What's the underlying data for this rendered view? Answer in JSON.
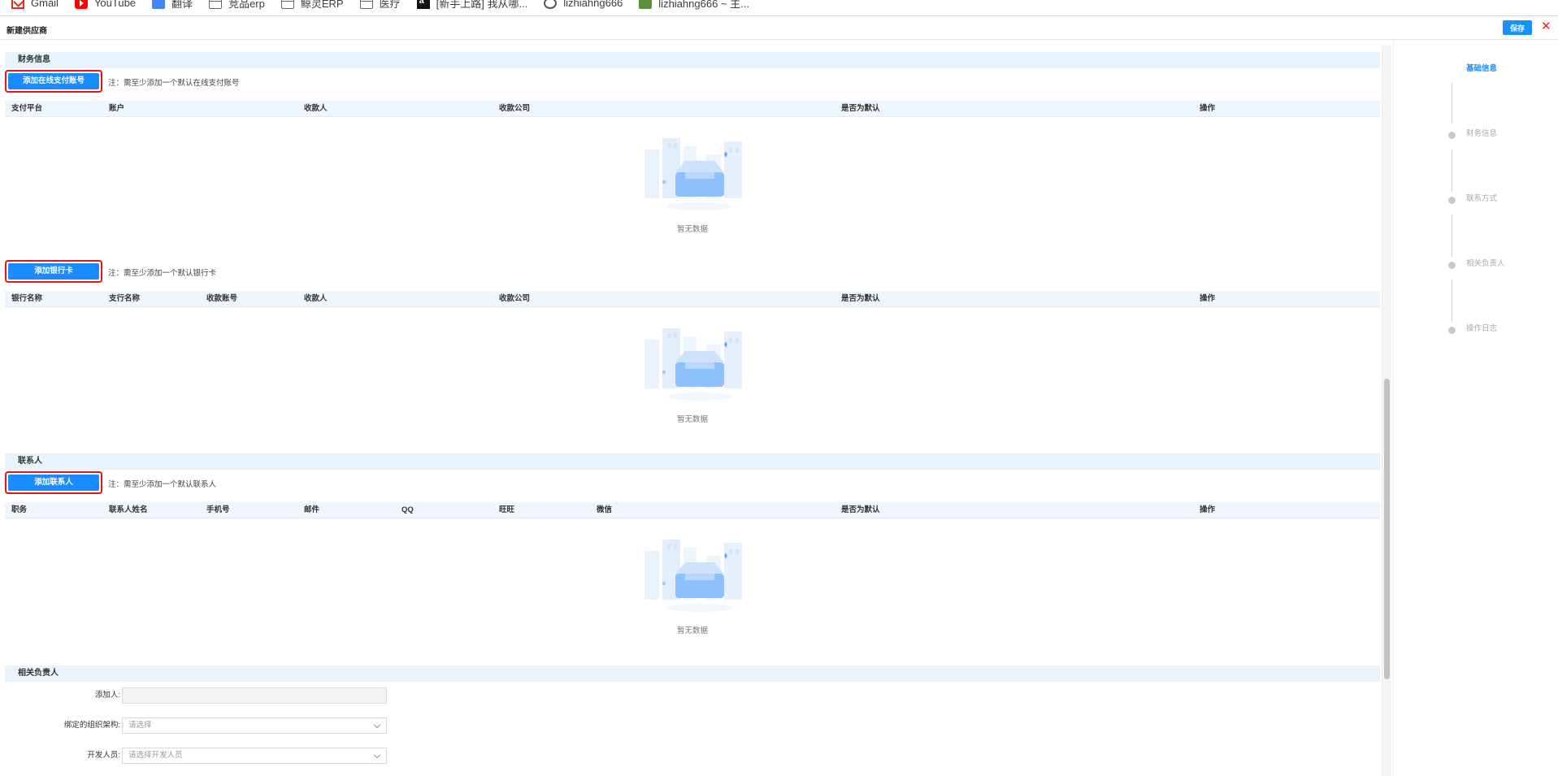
{
  "bookmarks": [
    {
      "label": "Gmail",
      "icon": "gmail-icon"
    },
    {
      "label": "YouTube",
      "icon": "youtube-icon"
    },
    {
      "label": "翻译",
      "icon": "translate-icon"
    },
    {
      "label": "竞品erp",
      "icon": "folder-icon"
    },
    {
      "label": "鲸灵ERP",
      "icon": "folder-icon"
    },
    {
      "label": "医疗",
      "icon": "folder-icon"
    },
    {
      "label": "[新手上路] 我从哪...",
      "icon": "amazon-icon"
    },
    {
      "label": "lizhiahng666",
      "icon": "globe-icon"
    },
    {
      "label": "lizhiahng666 ~ 主...",
      "icon": "shopify-icon"
    }
  ],
  "header": {
    "title": "新建供应商",
    "save_label": "保存",
    "close_label": "✕"
  },
  "finance": {
    "section_title": "财务信息",
    "online": {
      "add_label": "添加在线支付账号",
      "note": "注：需至少添加一个默认在线支付账号",
      "columns": [
        "支付平台",
        "账户",
        "收款人",
        "收款公司",
        "是否为默认",
        "操作"
      ],
      "empty_text": "暂无数据"
    },
    "bank": {
      "add_label": "添加银行卡",
      "note": "注：需至少添加一个默认银行卡",
      "columns": [
        "银行名称",
        "支行名称",
        "收款账号",
        "收款人",
        "收款公司",
        "是否为默认",
        "操作"
      ],
      "empty_text": "暂无数据"
    }
  },
  "contacts": {
    "section_title": "联系人",
    "add_label": "添加联系人",
    "note": "注：需至少添加一个默认联系人",
    "columns": [
      "职务",
      "联系人姓名",
      "手机号",
      "邮件",
      "QQ",
      "旺旺",
      "微信",
      "是否为默认",
      "操作"
    ],
    "empty_text": "暂无数据"
  },
  "responsible": {
    "section_title": "相关负责人",
    "fields": [
      {
        "label": "添加人:",
        "value": "",
        "placeholder": ""
      },
      {
        "label": "绑定的组织架构:",
        "value": "",
        "placeholder": "请选择"
      },
      {
        "label": "开发人员:",
        "value": "",
        "placeholder": "请选择开发人员"
      }
    ]
  },
  "steps": [
    {
      "label": "基础信息",
      "active": true
    },
    {
      "label": "财务信息",
      "active": false
    },
    {
      "label": "联系方式",
      "active": false
    },
    {
      "label": "相关负责人",
      "active": false
    },
    {
      "label": "操作日志",
      "active": false
    }
  ],
  "colors": {
    "primary": "#1a8cff",
    "highlight_border": "#e0141e",
    "section_bg": "#e9f3fd"
  }
}
